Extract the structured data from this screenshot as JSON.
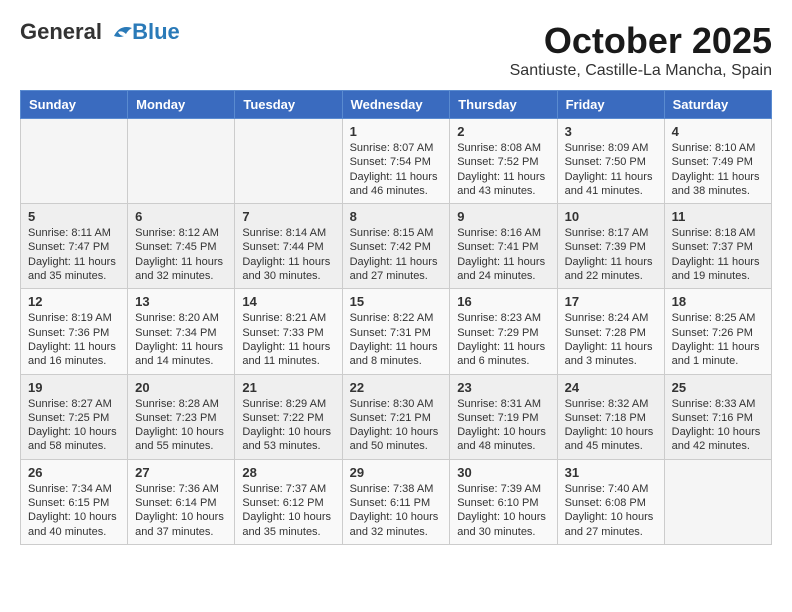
{
  "header": {
    "logo_line1": "General",
    "logo_line2": "Blue",
    "month": "October 2025",
    "location": "Santiuste, Castille-La Mancha, Spain"
  },
  "days_of_week": [
    "Sunday",
    "Monday",
    "Tuesday",
    "Wednesday",
    "Thursday",
    "Friday",
    "Saturday"
  ],
  "weeks": [
    [
      {
        "day": "",
        "info": ""
      },
      {
        "day": "",
        "info": ""
      },
      {
        "day": "",
        "info": ""
      },
      {
        "day": "1",
        "info": "Sunrise: 8:07 AM\nSunset: 7:54 PM\nDaylight: 11 hours\nand 46 minutes."
      },
      {
        "day": "2",
        "info": "Sunrise: 8:08 AM\nSunset: 7:52 PM\nDaylight: 11 hours\nand 43 minutes."
      },
      {
        "day": "3",
        "info": "Sunrise: 8:09 AM\nSunset: 7:50 PM\nDaylight: 11 hours\nand 41 minutes."
      },
      {
        "day": "4",
        "info": "Sunrise: 8:10 AM\nSunset: 7:49 PM\nDaylight: 11 hours\nand 38 minutes."
      }
    ],
    [
      {
        "day": "5",
        "info": "Sunrise: 8:11 AM\nSunset: 7:47 PM\nDaylight: 11 hours\nand 35 minutes."
      },
      {
        "day": "6",
        "info": "Sunrise: 8:12 AM\nSunset: 7:45 PM\nDaylight: 11 hours\nand 32 minutes."
      },
      {
        "day": "7",
        "info": "Sunrise: 8:14 AM\nSunset: 7:44 PM\nDaylight: 11 hours\nand 30 minutes."
      },
      {
        "day": "8",
        "info": "Sunrise: 8:15 AM\nSunset: 7:42 PM\nDaylight: 11 hours\nand 27 minutes."
      },
      {
        "day": "9",
        "info": "Sunrise: 8:16 AM\nSunset: 7:41 PM\nDaylight: 11 hours\nand 24 minutes."
      },
      {
        "day": "10",
        "info": "Sunrise: 8:17 AM\nSunset: 7:39 PM\nDaylight: 11 hours\nand 22 minutes."
      },
      {
        "day": "11",
        "info": "Sunrise: 8:18 AM\nSunset: 7:37 PM\nDaylight: 11 hours\nand 19 minutes."
      }
    ],
    [
      {
        "day": "12",
        "info": "Sunrise: 8:19 AM\nSunset: 7:36 PM\nDaylight: 11 hours\nand 16 minutes."
      },
      {
        "day": "13",
        "info": "Sunrise: 8:20 AM\nSunset: 7:34 PM\nDaylight: 11 hours\nand 14 minutes."
      },
      {
        "day": "14",
        "info": "Sunrise: 8:21 AM\nSunset: 7:33 PM\nDaylight: 11 hours\nand 11 minutes."
      },
      {
        "day": "15",
        "info": "Sunrise: 8:22 AM\nSunset: 7:31 PM\nDaylight: 11 hours\nand 8 minutes."
      },
      {
        "day": "16",
        "info": "Sunrise: 8:23 AM\nSunset: 7:29 PM\nDaylight: 11 hours\nand 6 minutes."
      },
      {
        "day": "17",
        "info": "Sunrise: 8:24 AM\nSunset: 7:28 PM\nDaylight: 11 hours\nand 3 minutes."
      },
      {
        "day": "18",
        "info": "Sunrise: 8:25 AM\nSunset: 7:26 PM\nDaylight: 11 hours\nand 1 minute."
      }
    ],
    [
      {
        "day": "19",
        "info": "Sunrise: 8:27 AM\nSunset: 7:25 PM\nDaylight: 10 hours\nand 58 minutes."
      },
      {
        "day": "20",
        "info": "Sunrise: 8:28 AM\nSunset: 7:23 PM\nDaylight: 10 hours\nand 55 minutes."
      },
      {
        "day": "21",
        "info": "Sunrise: 8:29 AM\nSunset: 7:22 PM\nDaylight: 10 hours\nand 53 minutes."
      },
      {
        "day": "22",
        "info": "Sunrise: 8:30 AM\nSunset: 7:21 PM\nDaylight: 10 hours\nand 50 minutes."
      },
      {
        "day": "23",
        "info": "Sunrise: 8:31 AM\nSunset: 7:19 PM\nDaylight: 10 hours\nand 48 minutes."
      },
      {
        "day": "24",
        "info": "Sunrise: 8:32 AM\nSunset: 7:18 PM\nDaylight: 10 hours\nand 45 minutes."
      },
      {
        "day": "25",
        "info": "Sunrise: 8:33 AM\nSunset: 7:16 PM\nDaylight: 10 hours\nand 42 minutes."
      }
    ],
    [
      {
        "day": "26",
        "info": "Sunrise: 7:34 AM\nSunset: 6:15 PM\nDaylight: 10 hours\nand 40 minutes."
      },
      {
        "day": "27",
        "info": "Sunrise: 7:36 AM\nSunset: 6:14 PM\nDaylight: 10 hours\nand 37 minutes."
      },
      {
        "day": "28",
        "info": "Sunrise: 7:37 AM\nSunset: 6:12 PM\nDaylight: 10 hours\nand 35 minutes."
      },
      {
        "day": "29",
        "info": "Sunrise: 7:38 AM\nSunset: 6:11 PM\nDaylight: 10 hours\nand 32 minutes."
      },
      {
        "day": "30",
        "info": "Sunrise: 7:39 AM\nSunset: 6:10 PM\nDaylight: 10 hours\nand 30 minutes."
      },
      {
        "day": "31",
        "info": "Sunrise: 7:40 AM\nSunset: 6:08 PM\nDaylight: 10 hours\nand 27 minutes."
      },
      {
        "day": "",
        "info": ""
      }
    ]
  ]
}
